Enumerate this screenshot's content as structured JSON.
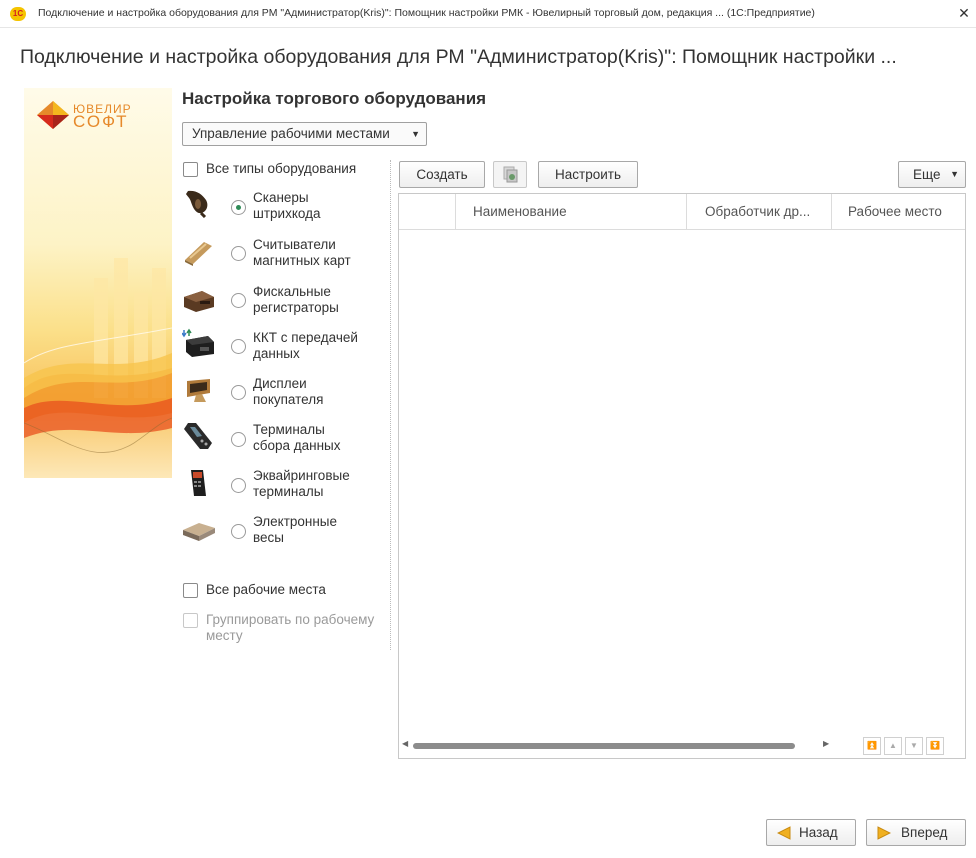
{
  "window": {
    "title": "Подключение и настройка оборудования для РМ \"Администратор(Kris)\": Помощник настройки РМК - Ювелирный торговый дом, редакция ... (1С:Предприятие)",
    "app_icon": "1С",
    "close_glyph": "✕"
  },
  "page": {
    "title": "Подключение и настройка оборудования для РМ \"Администратор(Kris)\": Помощник настройки ..."
  },
  "brand": {
    "line1": "ЮВЕЛИР",
    "line2": "СОФТ",
    "colors": {
      "orange": "#e6892a",
      "red": "#d62a1c",
      "yellow": "#f4b71e"
    }
  },
  "section": {
    "title": "Настройка торгового оборудования",
    "workplaces_menu": "Управление рабочими местами"
  },
  "filters": {
    "all_types": {
      "label": "Все типы оборудования",
      "checked": false
    },
    "all_workplaces": {
      "label": "Все рабочие места",
      "checked": false
    },
    "group_by_workplace": {
      "label_line1": "Группировать по рабочему",
      "label_line2": "месту",
      "checked": false,
      "enabled": false
    }
  },
  "equipment_types": [
    {
      "line1": "Сканеры",
      "line2": "штрихкода",
      "icon": "barcode-scanner-icon",
      "selected": true
    },
    {
      "line1": "Считыватели",
      "line2": "магнитных карт",
      "icon": "card-reader-icon",
      "selected": false
    },
    {
      "line1": "Фискальные",
      "line2": "регистраторы",
      "icon": "fiscal-printer-icon",
      "selected": false
    },
    {
      "line1": "ККТ с передачей",
      "line2": "данных",
      "icon": "cash-register-icon",
      "selected": false
    },
    {
      "line1": "Дисплеи",
      "line2": "покупателя",
      "icon": "customer-display-icon",
      "selected": false
    },
    {
      "line1": "Терминалы",
      "line2": "сбора данных",
      "icon": "data-terminal-icon",
      "selected": false
    },
    {
      "line1": "Эквайринговые",
      "line2": "терминалы",
      "icon": "pos-terminal-icon",
      "selected": false
    },
    {
      "line1": "Электронные",
      "line2": "весы",
      "icon": "scales-icon",
      "selected": false
    }
  ],
  "toolbar": {
    "create": "Создать",
    "configure": "Настроить",
    "more": "Еще"
  },
  "table": {
    "columns": [
      "Наименование",
      "Обработчик др...",
      "Рабочее место"
    ],
    "rows": []
  },
  "wizard": {
    "back": "Назад",
    "next": "Вперед"
  }
}
